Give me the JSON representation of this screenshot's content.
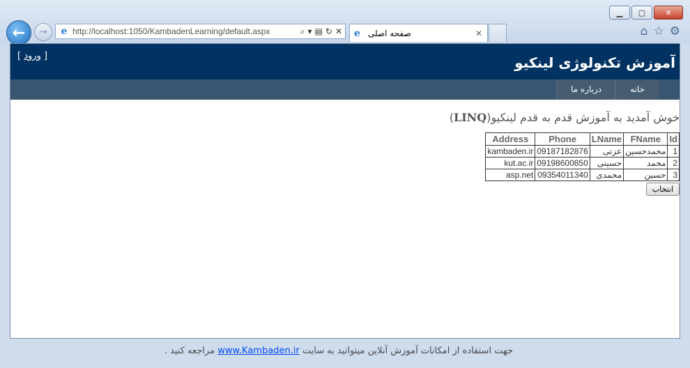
{
  "browser": {
    "address_url": "http://localhost:1050/KambadenLearning/default.aspx",
    "tab_title": "صفحه اصلی",
    "window_buttons": [
      "minimize",
      "maximize",
      "close"
    ],
    "toolbar_icons": [
      "home-icon",
      "star-icon",
      "gear-icon"
    ]
  },
  "header": {
    "site_title": "آموزش تکنولوژی لینکیو",
    "login_open": "[ ",
    "login_label": "ورود",
    "login_close": " ]"
  },
  "menu": {
    "items": [
      {
        "label": "خانه"
      },
      {
        "label": "درباره ما"
      }
    ]
  },
  "main": {
    "welcome_text": "خوش آمدید به آموزش قدم به قدم لینکیو(",
    "welcome_linq": "LINQ",
    "welcome_close": ")",
    "table": {
      "columns": [
        "Id",
        "FName",
        "LName",
        "Phone",
        "Address"
      ],
      "rows": [
        [
          "1",
          "محمدحسین",
          "عزتی",
          "09187182876",
          "kambaden.ir"
        ],
        [
          "2",
          "محمد",
          "حسینی",
          "09198600850",
          "kut.ac.ir"
        ],
        [
          "3",
          "حسین",
          "محمدی",
          "09354011340",
          "asp.net"
        ]
      ]
    },
    "select_button": "انتخاب"
  },
  "footer": {
    "text_before": "جهت استفاده از امکانات آموزش آنلاین میتوانید به سایت ",
    "link": "www.Kambaden.ir",
    "text_after": " مراجعه کنید ."
  }
}
